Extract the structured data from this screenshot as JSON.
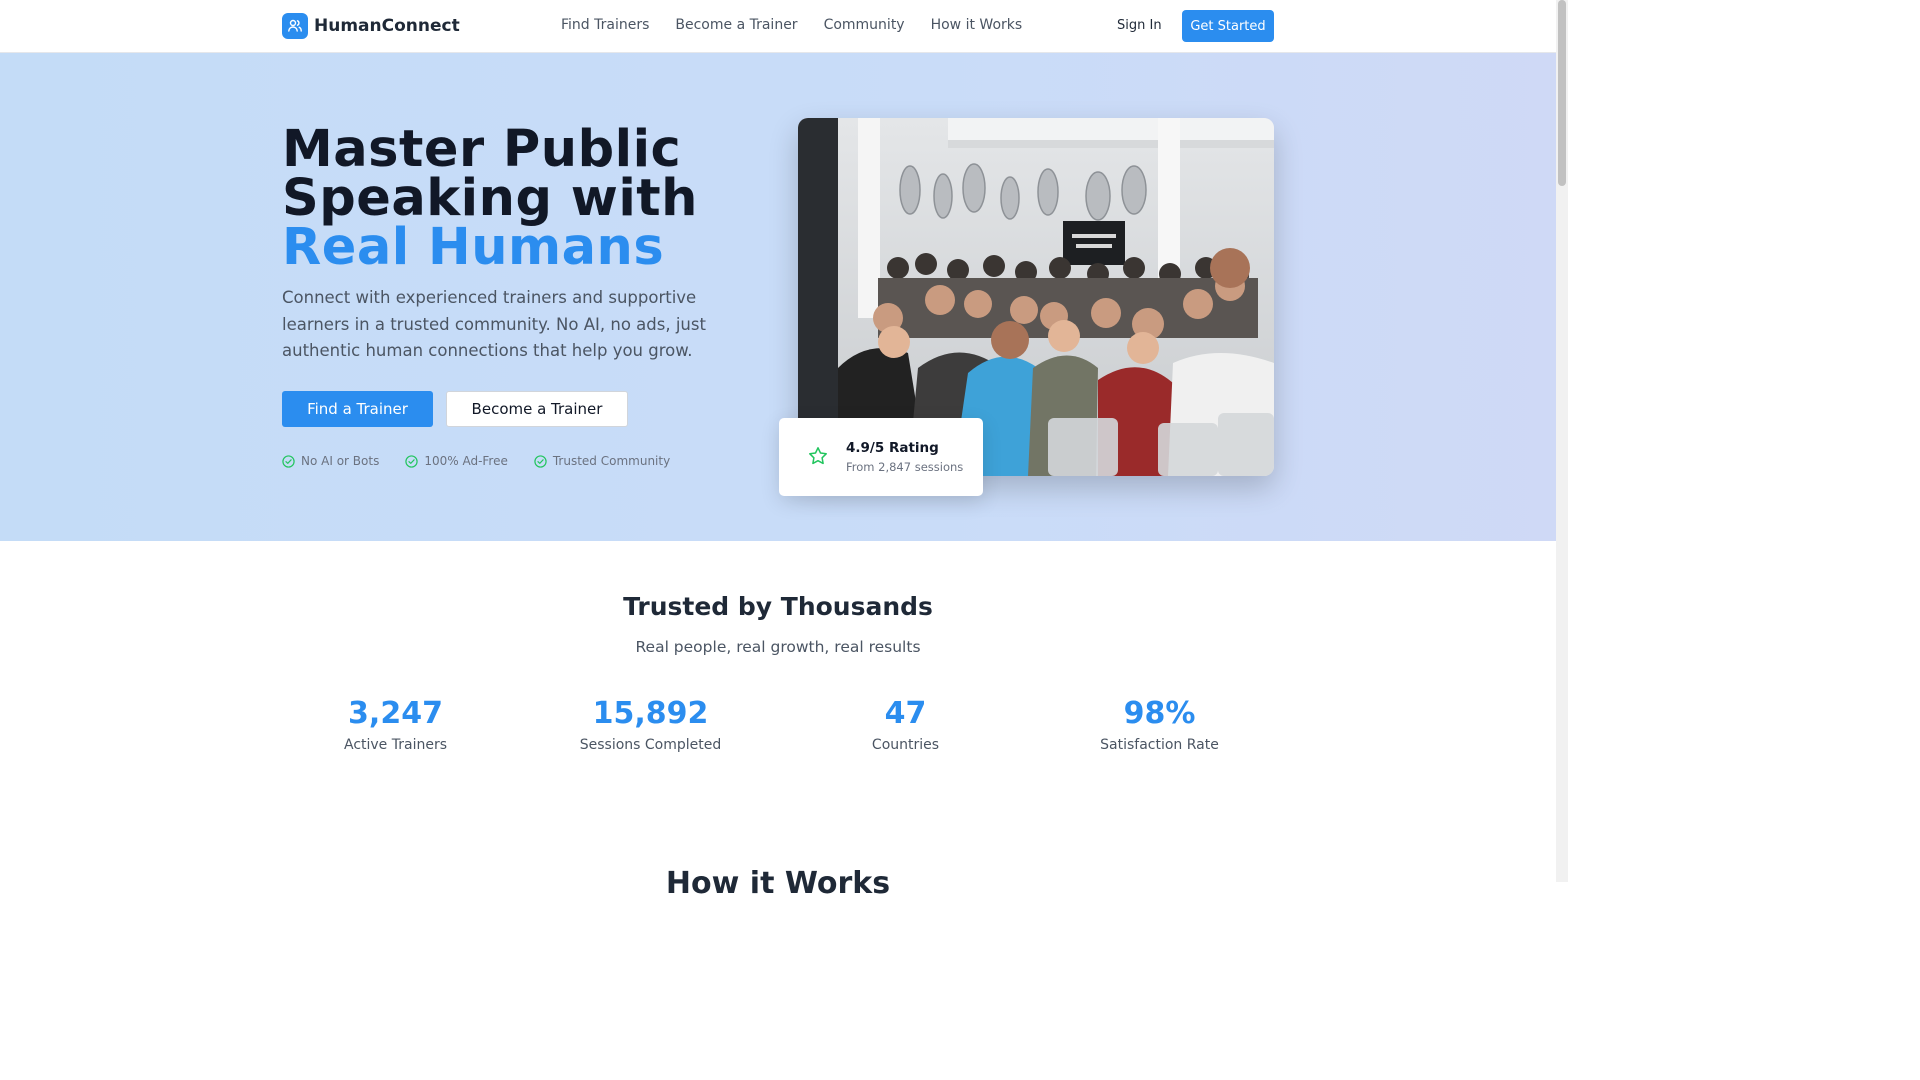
{
  "brand": {
    "name": "HumanConnect",
    "logo_icon": "users-icon",
    "accent_color": "#2b8def"
  },
  "nav": {
    "items": [
      "Find Trainers",
      "Become a Trainer",
      "Community",
      "How it Works"
    ],
    "sign_in": "Sign In",
    "get_started": "Get Started"
  },
  "hero": {
    "title_line1": "Master Public",
    "title_line2": "Speaking with",
    "title_accent": "Real Humans",
    "subtitle": "Connect with experienced trainers and supportive learners in a trusted community. No AI, no ads, just authentic human connections that help you grow.",
    "primary_button": "Find a Trainer",
    "secondary_button": "Become a Trainer",
    "features": [
      "No AI or Bots",
      "100% Ad-Free",
      "Trusted Community"
    ],
    "feature_icon": "check-circle-icon"
  },
  "rating_card": {
    "icon": "star-icon",
    "title": "4.9/5 Rating",
    "subtitle": "From 2,847 sessions"
  },
  "stats": {
    "title": "Trusted by Thousands",
    "subtitle": "Real people, real growth, real results",
    "items": [
      {
        "value": "3,247",
        "label": "Active Trainers"
      },
      {
        "value": "15,892",
        "label": "Sessions Completed"
      },
      {
        "value": "47",
        "label": "Countries"
      },
      {
        "value": "98%",
        "label": "Satisfaction Rate"
      }
    ]
  },
  "next_section": {
    "title": "How it Works"
  }
}
